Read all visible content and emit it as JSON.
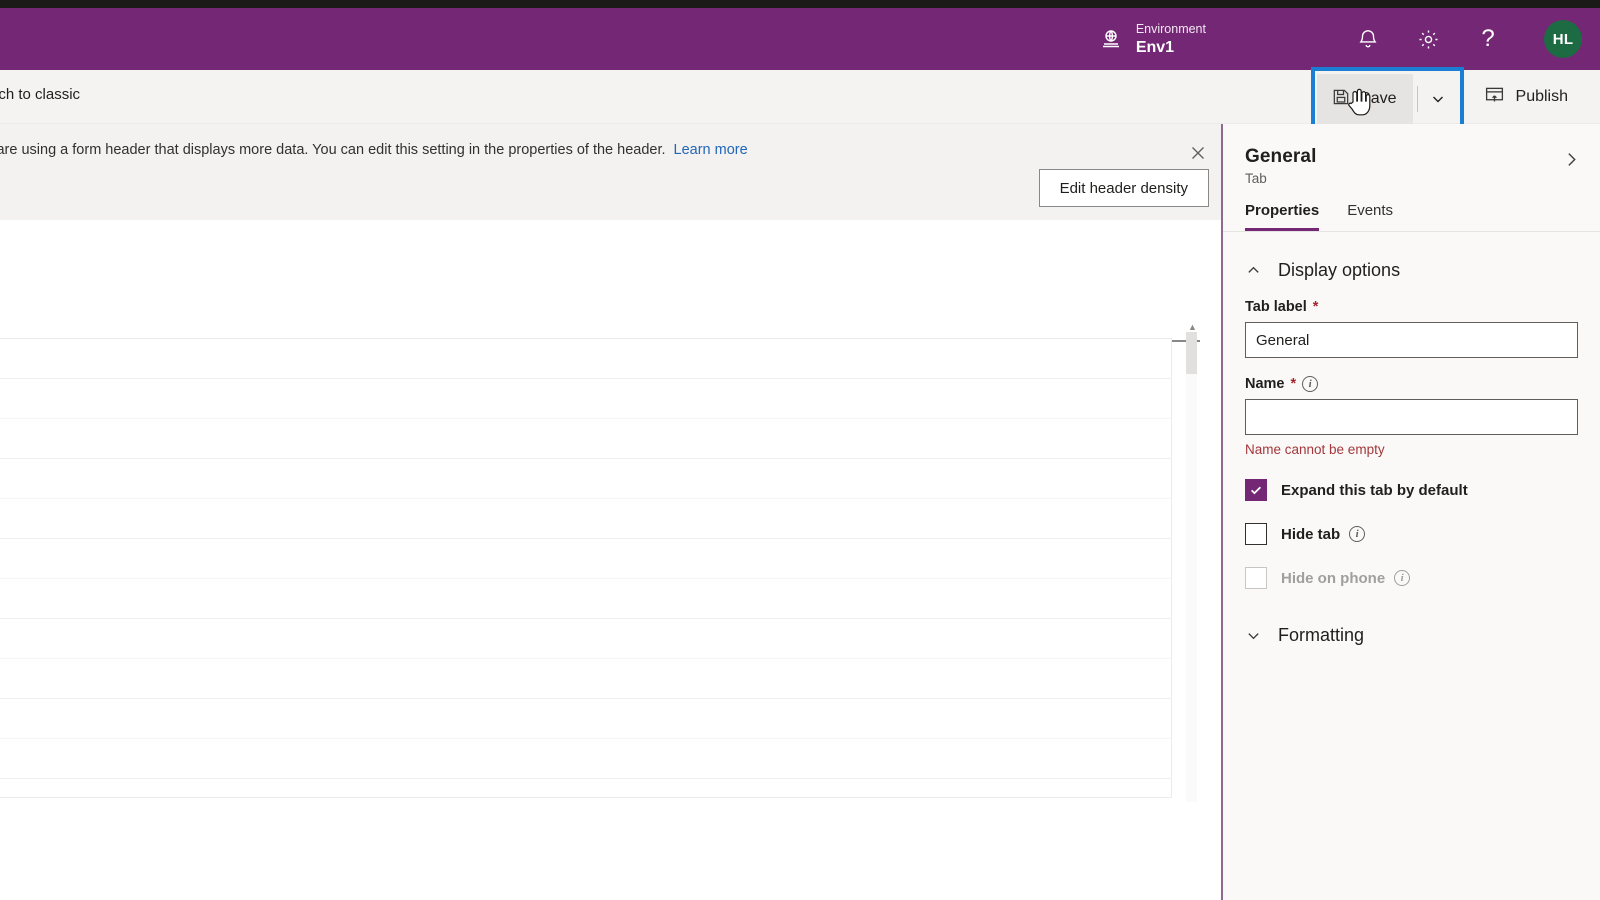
{
  "appbar": {
    "environment_label": "Environment",
    "environment_name": "Env1",
    "waffle_icon": "environment-globe-icon",
    "notification_icon": "bell-icon",
    "settings_icon": "gear-icon",
    "help_icon": "question-mark-icon",
    "help_glyph": "?",
    "avatar_initials": "HL",
    "avatar_color": "#1d6b42",
    "bar_color": "#742774"
  },
  "commandbar": {
    "classic_text": "Switch to classic",
    "save_label": "Save",
    "save_icon": "save-disk-icon",
    "save_chevron_icon": "chevron-down-icon",
    "publish_label": "Publish",
    "publish_icon": "publish-window-icon",
    "highlight_color": "#1a7fd4"
  },
  "notification": {
    "message": "You are using a form header that displays more data. You can edit this setting in the properties of the header.",
    "link_label": "Learn more",
    "close_icon": "close-icon",
    "density_button_label": "Edit header density"
  },
  "panel": {
    "title": "General",
    "subtitle": "Tab",
    "expand_icon": "chevron-right-icon",
    "tabs": [
      {
        "label": "Properties",
        "active": true
      },
      {
        "label": "Events",
        "active": false
      }
    ],
    "sections": [
      {
        "title": "Display options",
        "expanded": true,
        "chevron_icon": "chevron-up-icon"
      },
      {
        "title": "Formatting",
        "expanded": false,
        "chevron_icon": "chevron-down-icon"
      }
    ],
    "fields": [
      {
        "label": "Tab label",
        "required": true,
        "has_info": false,
        "value": "General",
        "error": ""
      },
      {
        "label": "Name",
        "required": true,
        "has_info": true,
        "value": "",
        "error": "Name cannot be empty"
      }
    ],
    "checkboxes": [
      {
        "label": "Expand this tab by default",
        "checked": true,
        "disabled": false,
        "has_info": false
      },
      {
        "label": "Hide tab",
        "checked": false,
        "disabled": false,
        "has_info": true
      },
      {
        "label": "Hide on phone",
        "checked": false,
        "disabled": true,
        "has_info": true
      }
    ],
    "accent_color": "#742774",
    "error_color": "#a4373a"
  }
}
